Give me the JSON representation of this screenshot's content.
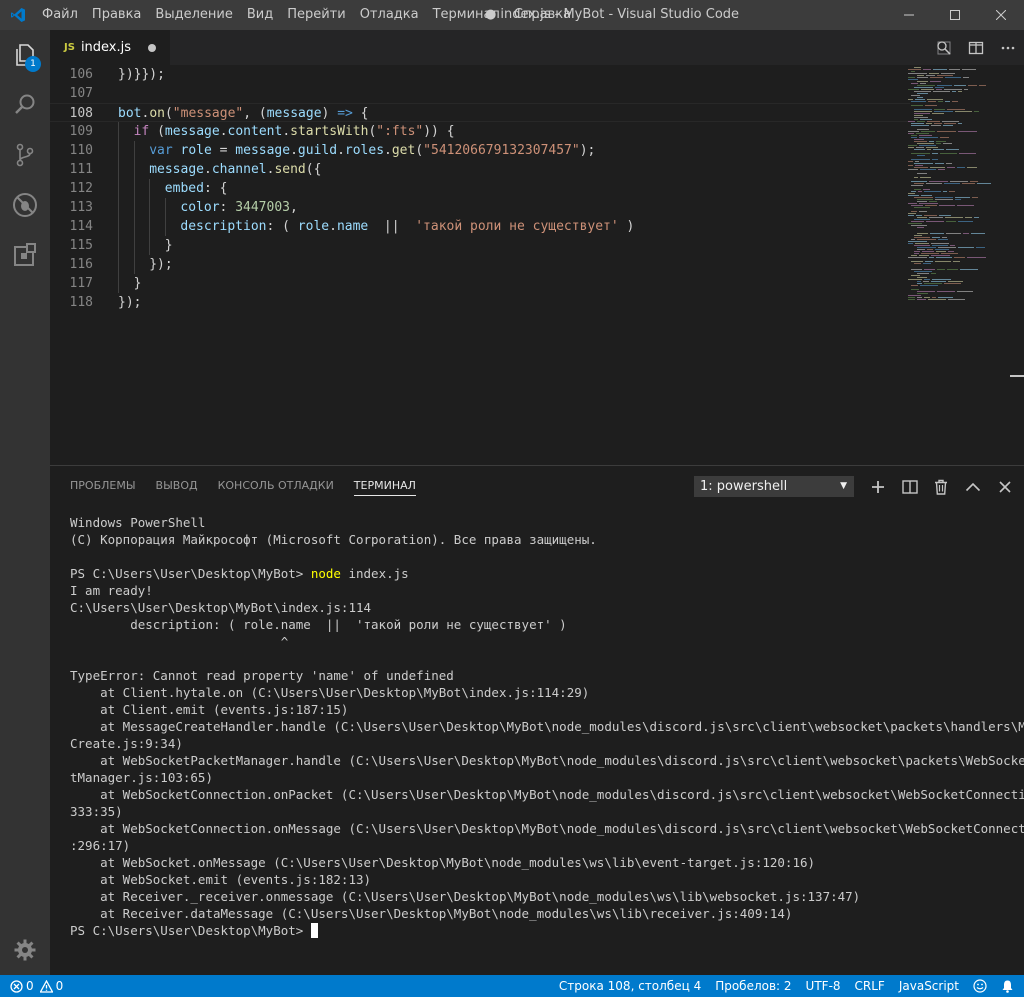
{
  "window": {
    "title": "● index.js - MyBot - Visual Studio Code"
  },
  "menu": [
    "Файл",
    "Правка",
    "Выделение",
    "Вид",
    "Перейти",
    "Отладка",
    "Терминал",
    "Справка"
  ],
  "activity_bar": {
    "explorer_badge": "1"
  },
  "tab": {
    "icon_label": "JS",
    "filename": "index.js"
  },
  "editor": {
    "lines": [
      {
        "n": "106",
        "indent": 0,
        "tokens": [
          [
            "p",
            "})}});"
          ]
        ]
      },
      {
        "n": "107",
        "indent": 0,
        "tokens": []
      },
      {
        "n": "108",
        "indent": 0,
        "current": true,
        "tokens": [
          [
            "var",
            "bot"
          ],
          [
            "p",
            "."
          ],
          [
            "fn",
            "on"
          ],
          [
            "p",
            "("
          ],
          [
            "str",
            "\"message\""
          ],
          [
            "p",
            ", ("
          ],
          [
            "var",
            "message"
          ],
          [
            "p",
            ") "
          ],
          [
            "kwb",
            "=>"
          ],
          [
            "p",
            " {"
          ]
        ]
      },
      {
        "n": "109",
        "indent": 1,
        "tokens": [
          [
            "kw",
            "if"
          ],
          [
            "p",
            " ("
          ],
          [
            "var",
            "message"
          ],
          [
            "p",
            "."
          ],
          [
            "var",
            "content"
          ],
          [
            "p",
            "."
          ],
          [
            "fn",
            "startsWith"
          ],
          [
            "p",
            "("
          ],
          [
            "str",
            "\":fts\""
          ],
          [
            "p",
            ")) {"
          ]
        ]
      },
      {
        "n": "110",
        "indent": 2,
        "tokens": [
          [
            "kwb",
            "var"
          ],
          [
            "p",
            " "
          ],
          [
            "var",
            "role"
          ],
          [
            "p",
            " = "
          ],
          [
            "var",
            "message"
          ],
          [
            "p",
            "."
          ],
          [
            "var",
            "guild"
          ],
          [
            "p",
            "."
          ],
          [
            "var",
            "roles"
          ],
          [
            "p",
            "."
          ],
          [
            "fn",
            "get"
          ],
          [
            "p",
            "("
          ],
          [
            "str",
            "\"541206679132307457\""
          ],
          [
            "p",
            ");"
          ]
        ]
      },
      {
        "n": "111",
        "indent": 2,
        "tokens": [
          [
            "var",
            "message"
          ],
          [
            "p",
            "."
          ],
          [
            "var",
            "channel"
          ],
          [
            "p",
            "."
          ],
          [
            "fn",
            "send"
          ],
          [
            "p",
            "({"
          ]
        ]
      },
      {
        "n": "112",
        "indent": 3,
        "tokens": [
          [
            "var",
            "embed"
          ],
          [
            "p",
            ": {"
          ]
        ]
      },
      {
        "n": "113",
        "indent": 4,
        "tokens": [
          [
            "var",
            "color"
          ],
          [
            "p",
            ": "
          ],
          [
            "num",
            "3447003"
          ],
          [
            "p",
            ","
          ]
        ]
      },
      {
        "n": "114",
        "indent": 4,
        "tokens": [
          [
            "var",
            "description"
          ],
          [
            "p",
            ": ( "
          ],
          [
            "var",
            "role"
          ],
          [
            "p",
            "."
          ],
          [
            "var",
            "name"
          ],
          [
            "p",
            "  ||  "
          ],
          [
            "str",
            "'такой роли не существует'"
          ],
          [
            "p",
            " )"
          ]
        ]
      },
      {
        "n": "115",
        "indent": 3,
        "tokens": [
          [
            "p",
            "}"
          ]
        ]
      },
      {
        "n": "116",
        "indent": 2,
        "tokens": [
          [
            "p",
            "});"
          ]
        ]
      },
      {
        "n": "117",
        "indent": 1,
        "tokens": [
          [
            "p",
            "}"
          ]
        ]
      },
      {
        "n": "118",
        "indent": 0,
        "tokens": [
          [
            "p",
            "});"
          ]
        ]
      }
    ]
  },
  "panel": {
    "tabs": [
      "ПРОБЛЕМЫ",
      "ВЫВОД",
      "КОНСОЛЬ ОТЛАДКИ",
      "ТЕРМИНАЛ"
    ],
    "active_tab": "ТЕРМИНАЛ",
    "terminal_select": "1: powershell"
  },
  "terminal": {
    "lines": [
      "Windows PowerShell",
      "(C) Корпорация Майкрософт (Microsoft Corporation). Все права защищены.",
      "",
      {
        "prompt": "PS C:\\Users\\User\\Desktop\\MyBot> ",
        "cmd": "node",
        "args": " index.js"
      },
      "I am ready!",
      "C:\\Users\\User\\Desktop\\MyBot\\index.js:114",
      "        description: ( role.name  ||  'такой роли не существует' )",
      "                            ^",
      "",
      "TypeError: Cannot read property 'name' of undefined",
      "    at Client.hytale.on (C:\\Users\\User\\Desktop\\MyBot\\index.js:114:29)",
      "    at Client.emit (events.js:187:15)",
      "    at MessageCreateHandler.handle (C:\\Users\\User\\Desktop\\MyBot\\node_modules\\discord.js\\src\\client\\websocket\\packets\\handlers\\Message",
      "Create.js:9:34)",
      "    at WebSocketPacketManager.handle (C:\\Users\\User\\Desktop\\MyBot\\node_modules\\discord.js\\src\\client\\websocket\\packets\\WebSocketPacke",
      "tManager.js:103:65)",
      "    at WebSocketConnection.onPacket (C:\\Users\\User\\Desktop\\MyBot\\node_modules\\discord.js\\src\\client\\websocket\\WebSocketConnection.js:",
      "333:35)",
      "    at WebSocketConnection.onMessage (C:\\Users\\User\\Desktop\\MyBot\\node_modules\\discord.js\\src\\client\\websocket\\WebSocketConnection.js",
      ":296:17)",
      "    at WebSocket.onMessage (C:\\Users\\User\\Desktop\\MyBot\\node_modules\\ws\\lib\\event-target.js:120:16)",
      "    at WebSocket.emit (events.js:182:13)",
      "    at Receiver._receiver.onmessage (C:\\Users\\User\\Desktop\\MyBot\\node_modules\\ws\\lib\\websocket.js:137:47)",
      "    at Receiver.dataMessage (C:\\Users\\User\\Desktop\\MyBot\\node_modules\\ws\\lib\\receiver.js:409:14)",
      {
        "prompt": "PS C:\\Users\\User\\Desktop\\MyBot> ",
        "cursor": true
      }
    ]
  },
  "status": {
    "errors": "0",
    "warnings": "0",
    "position": "Строка 108, столбец 4",
    "spaces": "Пробелов: 2",
    "encoding": "UTF-8",
    "eol": "CRLF",
    "language": "JavaScript"
  },
  "colors": {
    "accent": "#007acc",
    "activity_bar": "#333333",
    "editor_bg": "#1e1e1e",
    "titlebar": "#3c3c3c"
  }
}
